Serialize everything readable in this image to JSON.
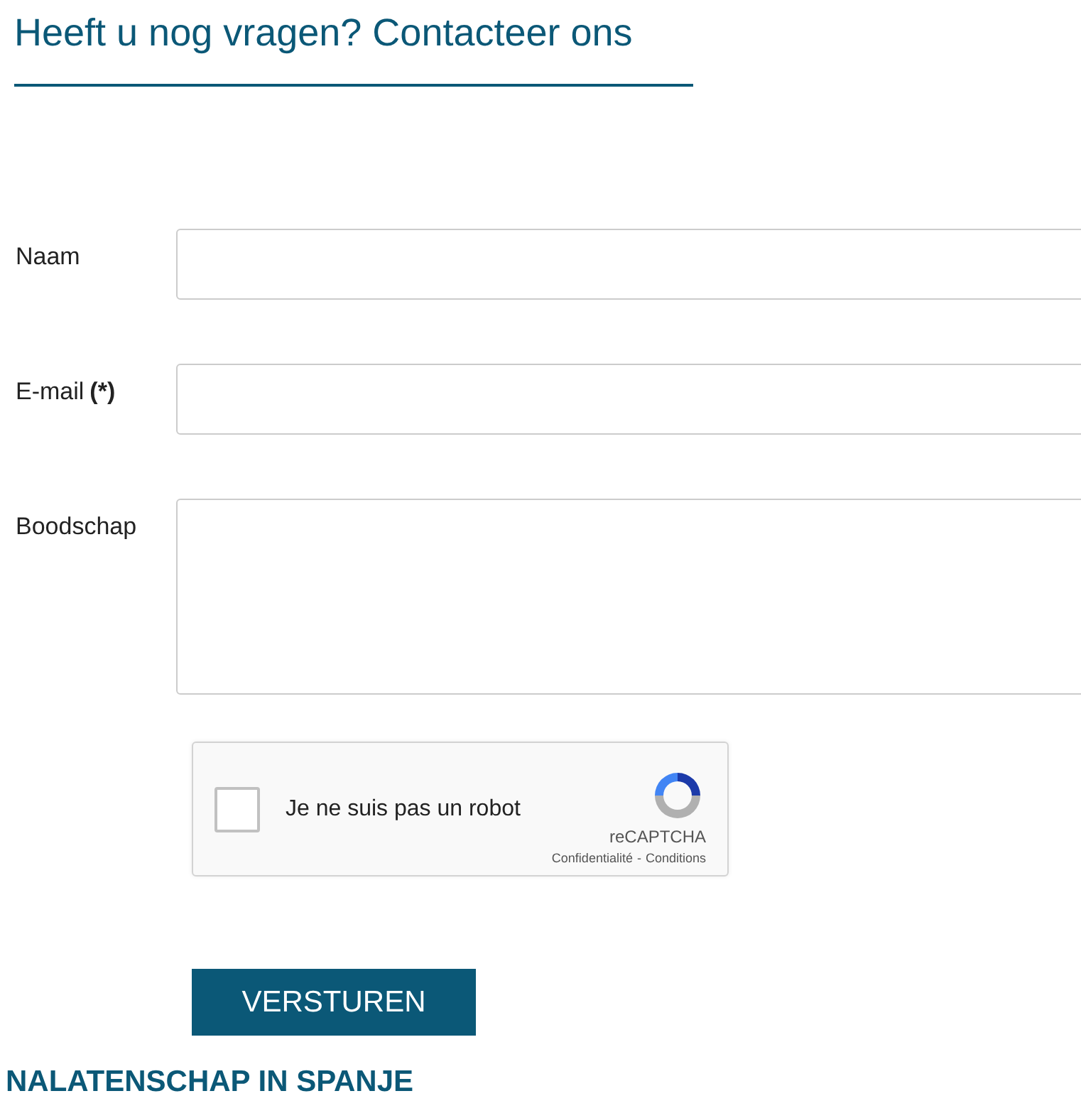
{
  "title": "Heeft u nog vragen? Contacteer ons",
  "fields": [
    {
      "kind": "input",
      "label": "Naam"
    },
    {
      "kind": "input",
      "label": "E-mail",
      "required": "(*)"
    },
    {
      "kind": "textarea",
      "label": "Boodschap"
    }
  ],
  "captcha": {
    "label": "Je ne suis pas un robot",
    "checked": false,
    "brand": "reCAPTCHA",
    "privacy": "Confidentialité",
    "separator": "-",
    "terms": "Conditions"
  },
  "submit": "VERSTUREN",
  "next_heading": "NALATENSCHAP IN SPANJE"
}
